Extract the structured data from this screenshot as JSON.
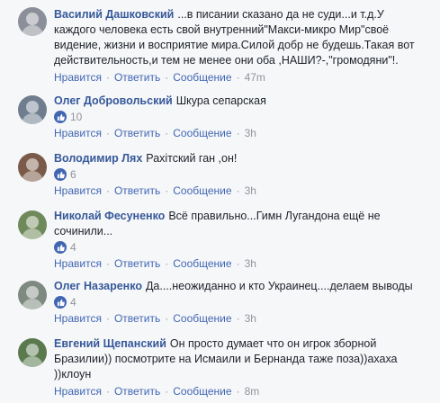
{
  "actions": {
    "like": "Нравится",
    "reply": "Ответить",
    "message": "Сообщение",
    "separator": "·"
  },
  "comments": [
    {
      "author": "Василий Дашковский",
      "text_lines": [
        "...в писании сказано да не суди...и т.д.У",
        "каждого человека есть свой внутренний\"Макси-микро Мир\"своё",
        "видение, жизни и восприятие мира.Силой добр не будешь.Такая вот",
        "действительность,и тем не менее они оба ,НАШИ?-,\"громодяни\"!."
      ],
      "likes": "",
      "time": "47m",
      "avatar_color": "#8a8f99"
    },
    {
      "author": "Олег Добровольский",
      "text_lines": [
        "Шкура сепарская"
      ],
      "likes": "10",
      "time": "3h",
      "avatar_color": "#6f7e8e"
    },
    {
      "author": "Володимир Лях",
      "text_lines": [
        "Рахітский ган ,он!"
      ],
      "likes": "6",
      "time": "3h",
      "avatar_color": "#7a5a48"
    },
    {
      "author": "Николай Фесуненко",
      "text_lines": [
        "Всё правильно...Гимн Лугандона ещё не",
        "сочинили..."
      ],
      "likes": "4",
      "time": "3h",
      "avatar_color": "#6f8a5a"
    },
    {
      "author": "Олег Назаренко",
      "text_lines": [
        "Да....неожиданно и кто Украинец....делаем выводы"
      ],
      "likes": "4",
      "time": "3h",
      "avatar_color": "#7e8a80"
    },
    {
      "author": "Евгений Щепанский",
      "text_lines": [
        "Он просто думает что он игрок зборной",
        "Бразилии)) посмотрите на Исмаили и Бернанда таже поза))ахаха",
        "))клоун"
      ],
      "likes": "",
      "time": "8m",
      "avatar_color": "#5a7a4e"
    }
  ]
}
